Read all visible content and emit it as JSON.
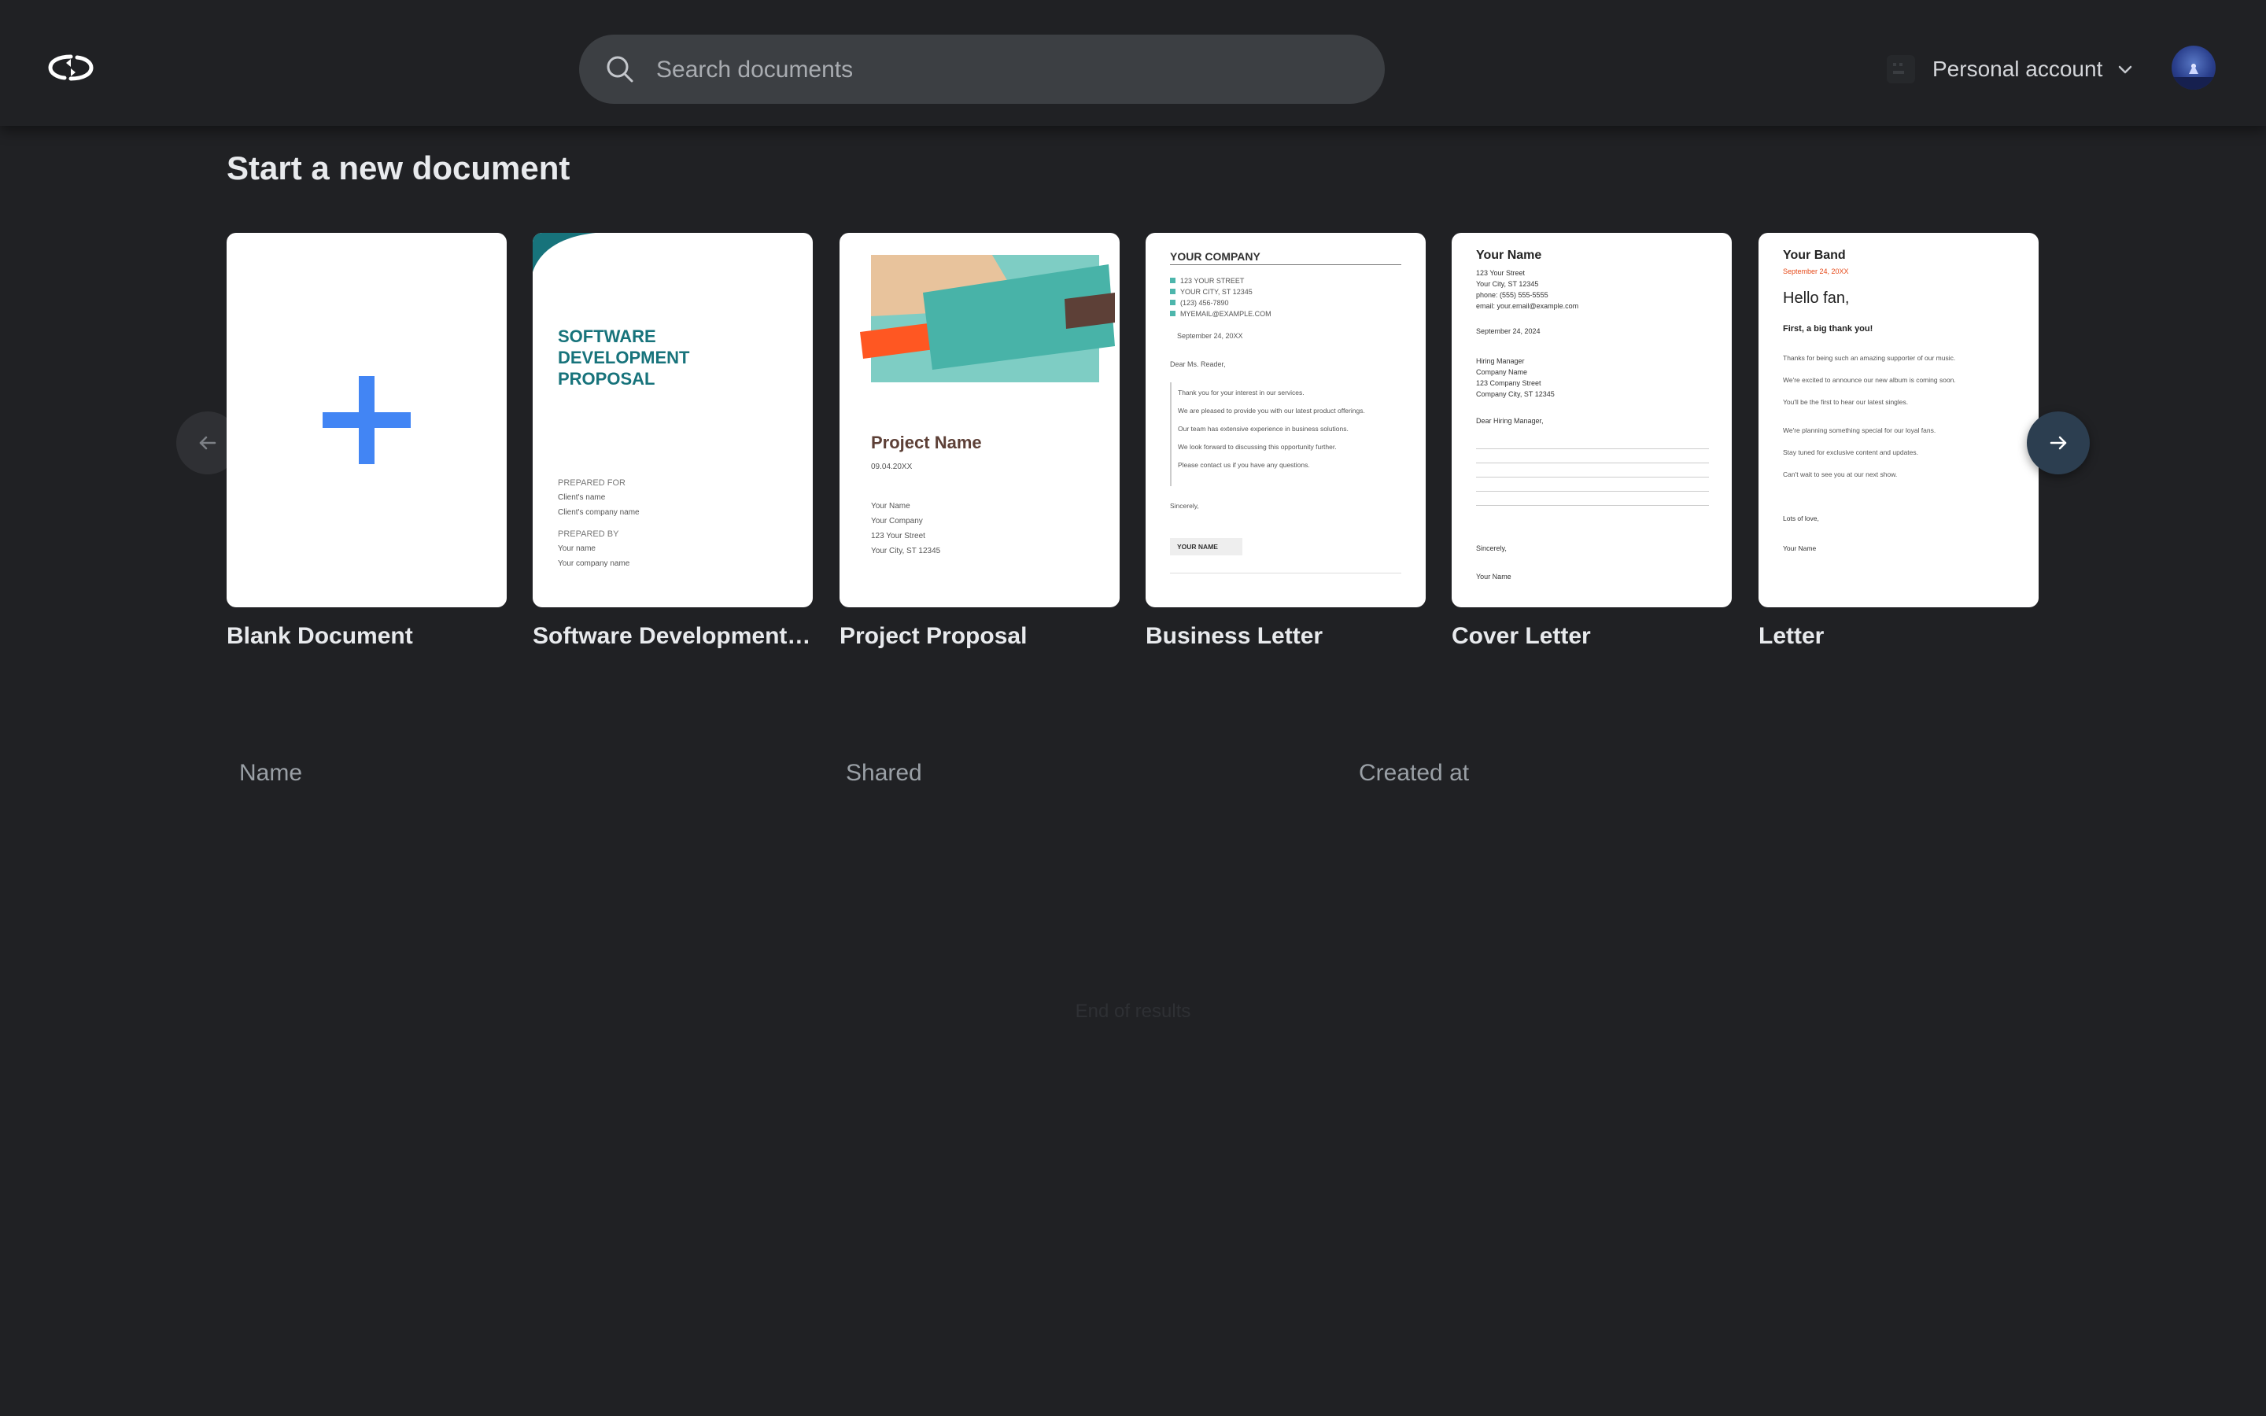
{
  "header": {
    "search_placeholder": "Search documents",
    "account_label": "Personal account"
  },
  "section_title": "Start a new document",
  "templates": [
    {
      "label": "Blank Document"
    },
    {
      "label": "Software Development P...",
      "title_lines": [
        "SOFTWARE",
        "DEVELOPMENT",
        "PROPOSAL"
      ],
      "prepared_for": "PREPARED FOR",
      "client_name": "Client's name",
      "client_company": "Client's company name",
      "prepared_by": "PREPARED BY",
      "your_name": "Your name",
      "your_company": "Your company name",
      "accent": "#17737b"
    },
    {
      "label": "Project Proposal",
      "project_name": "Project Name",
      "date": "09.04.20XX",
      "lines": [
        "Your Name",
        "Your Company",
        "123 Your Street",
        "Your City, ST 12345"
      ]
    },
    {
      "label": "Business Letter",
      "company": "YOUR COMPANY",
      "contact": [
        "123 YOUR STREET",
        "YOUR CITY, ST 12345",
        "(123) 456-7890",
        "MYEMAIL@EXAMPLE.COM"
      ],
      "date": "September 24, 20XX",
      "greeting": "Dear Ms. Reader,",
      "body": [
        "Thank you for your interest in our services.",
        "We are pleased to provide you with our latest product offerings.",
        "Our team has extensive experience in business solutions.",
        "We look forward to discussing this opportunity further.",
        "Please contact us if you have any questions."
      ],
      "closing": "Sincerely,",
      "signature": "YOUR NAME"
    },
    {
      "label": "Cover Letter",
      "name": "Your Name",
      "address": [
        "123 Your Street",
        "Your City, ST 12345",
        "phone: (555) 555-5555",
        "email: your.email@example.com"
      ],
      "date": "September 24, 2024",
      "recipient": [
        "Hiring Manager",
        "Company Name",
        "123 Company Street",
        "Company City, ST 12345"
      ],
      "greeting": "Dear Hiring Manager,",
      "closing": "Sincerely,",
      "signature": "Your Name"
    },
    {
      "label": "Letter",
      "band": "Your Band",
      "date": "September 24, 20XX",
      "hello": "Hello fan,",
      "subtitle": "First, a big thank you!",
      "body": [
        "Thanks for being such an amazing supporter of our music.",
        "We're excited to announce our new album is coming soon.",
        "You'll be the first to hear our latest singles.",
        "We're planning something special for our loyal fans.",
        "Stay tuned for exclusive content and updates.",
        "Can't wait to see you at our next show."
      ],
      "closing": "Lots of love,",
      "signature": "Your Name"
    }
  ],
  "table": {
    "columns": [
      "Name",
      "Shared",
      "Created at"
    ],
    "end_text": "End of results"
  },
  "colors": {
    "background": "#202124",
    "search_bg": "#3c3f43",
    "plus_blue": "#4285f4",
    "next_button": "#2c3e50"
  },
  "icons": [
    "app-logo-icon",
    "search-icon",
    "account-icon",
    "chevron-down-icon",
    "arrow-left-icon",
    "arrow-right-icon",
    "plus-icon"
  ]
}
